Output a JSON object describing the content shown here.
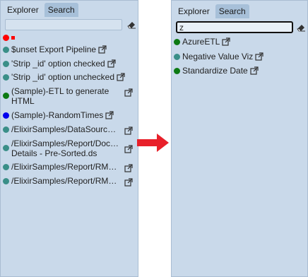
{
  "left": {
    "tabs": [
      {
        "label": "Explorer"
      },
      {
        "label": "Search"
      }
    ],
    "search": {
      "value": "",
      "placeholder": ""
    },
    "items": [
      {
        "label": "$unset Export Pipeline",
        "status_color": "#3a8f88"
      },
      {
        "label": "'Strip _id' option checked",
        "status_color": "#3a8f88"
      },
      {
        "label": "'Strip _id' option unchecked",
        "status_color": "#3a8f88"
      },
      {
        "label_line1": "(Sample)-ETL to generate",
        "label_line2": "HTML",
        "status_color": "#0c7a13"
      },
      {
        "label": "(Sample)-RandomTimes",
        "status_color": "#0000ee"
      },
      {
        "label": "/ElixirSamples/DataSource…",
        "status_color": "#3a8f88"
      },
      {
        "label_line1": "/ElixirSamples/Report/Doc…",
        "label_line2": "Details - Pre-Sorted.ds",
        "status_color": "#3a8f88"
      },
      {
        "label": "/ElixirSamples/Report/RML…",
        "status_color": "#3a8f88"
      },
      {
        "label": "/ElixirSamples/Report/RML…",
        "status_color": "#3a8f88"
      }
    ],
    "top_status_color": "#ff0000"
  },
  "right": {
    "tabs": [
      {
        "label": "Explorer"
      },
      {
        "label": "Search"
      }
    ],
    "search": {
      "value": "z",
      "placeholder": ""
    },
    "items": [
      {
        "label": "AzureETL",
        "status_color": "#0c7a13"
      },
      {
        "label": "Negative Value Viz",
        "status_color": "#3a8f88"
      },
      {
        "label": "Standardize Date",
        "status_color": "#0c7a13"
      }
    ]
  },
  "arrow_color": "#e8202a"
}
